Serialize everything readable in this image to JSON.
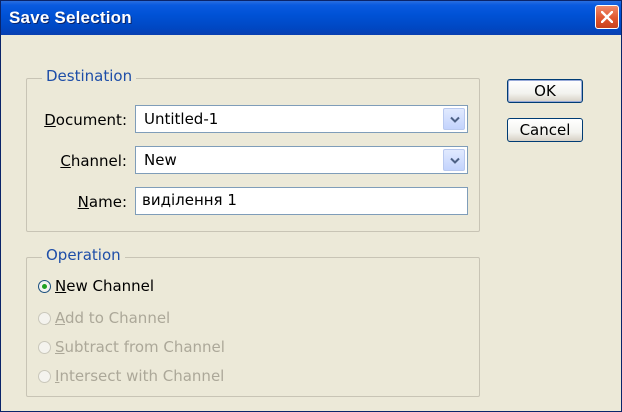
{
  "window": {
    "title": "Save Selection"
  },
  "destination": {
    "legend": "Destination",
    "document": {
      "label_accel": "D",
      "label_rest": "ocument:",
      "value": "Untitled-1"
    },
    "channel": {
      "label_accel": "C",
      "label_rest": "hannel:",
      "value": "New"
    },
    "name": {
      "label_accel": "N",
      "label_rest": "ame:",
      "value": "виділення 1"
    }
  },
  "buttons": {
    "ok": "OK",
    "cancel": "Cancel"
  },
  "operation": {
    "legend": "Operation",
    "options": [
      {
        "accel": "N",
        "rest": "ew Channel",
        "selected": true,
        "enabled": true
      },
      {
        "accel": "A",
        "rest": "dd to Channel",
        "selected": false,
        "enabled": false
      },
      {
        "accel": "S",
        "rest": "ubtract from Channel",
        "selected": false,
        "enabled": false
      },
      {
        "accel": "I",
        "rest": "ntersect with Channel",
        "selected": false,
        "enabled": false
      }
    ]
  },
  "icons": {
    "close": "close-icon",
    "dropdown": "chevron-down-icon"
  },
  "colors": {
    "titlebar": "#0052d6",
    "window_bg": "#ece9d8",
    "legend_text": "#1e4ea8",
    "disabled_text": "#aca899",
    "close_button": "#e0562f"
  }
}
